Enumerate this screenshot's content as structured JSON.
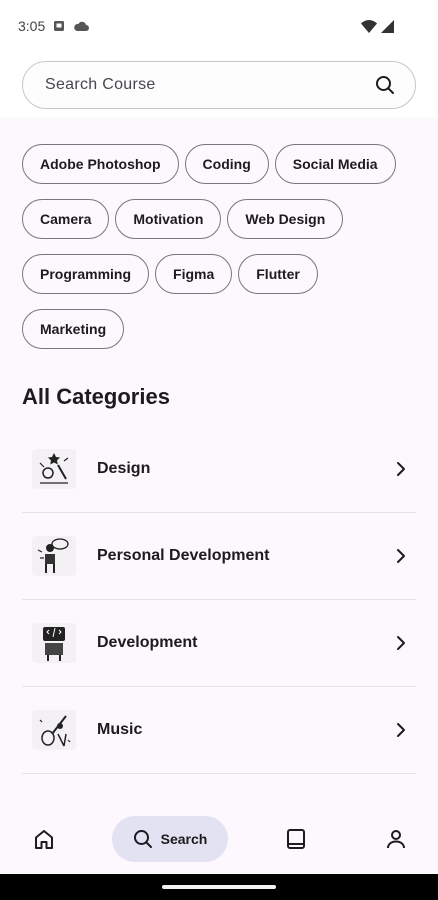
{
  "status_bar": {
    "time": "3:05",
    "icons": [
      "notification-square-icon",
      "cloud-icon",
      "wifi-icon",
      "cell-signal-icon"
    ]
  },
  "search": {
    "placeholder": "Search Course",
    "icon": "search-icon"
  },
  "chips": [
    [
      "Adobe Photoshop",
      "Coding",
      "Social Media"
    ],
    [
      "Camera",
      "Motivation",
      "Web Design"
    ],
    [
      "Programming",
      "Figma",
      "Flutter"
    ],
    [
      "Marketing"
    ]
  ],
  "categories": {
    "title": "All Categories",
    "items": [
      {
        "label": "Design",
        "icon": "design-illustration-icon"
      },
      {
        "label": "Personal Development",
        "icon": "personal-development-illustration-icon"
      },
      {
        "label": "Development",
        "icon": "development-illustration-icon"
      },
      {
        "label": "Music",
        "icon": "music-illustration-icon"
      }
    ]
  },
  "bottom_nav": {
    "items": [
      {
        "icon": "home-icon",
        "label": ""
      },
      {
        "icon": "search-icon",
        "label": "Search",
        "active": true
      },
      {
        "icon": "book-icon",
        "label": ""
      },
      {
        "icon": "profile-icon",
        "label": ""
      }
    ]
  },
  "colors": {
    "background": "#fdf8fd",
    "chip_border": "#79747e",
    "active_nav": "#e3e2f3",
    "text": "#1c1b1f"
  }
}
